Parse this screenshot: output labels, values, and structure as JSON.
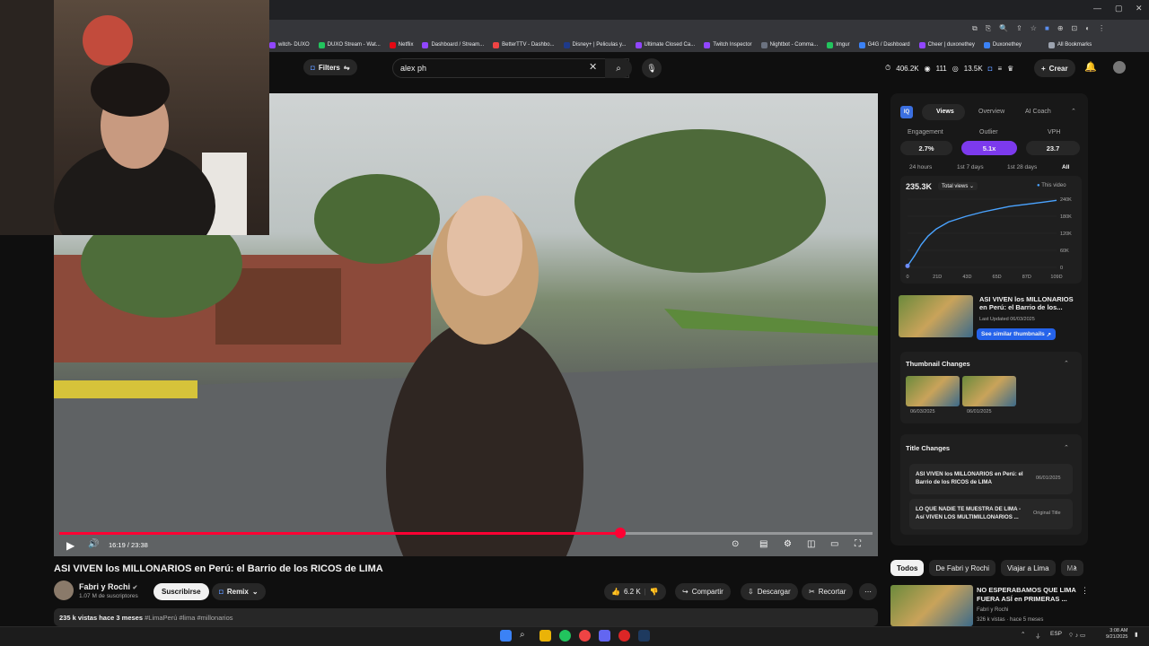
{
  "bookmarks": [
    "witch- DUXO",
    "DUXO Stream - Wat...",
    "Netflix",
    "Dashboard / Stream...",
    "BetterTTV - Dashbo...",
    "Disney+ | Peliculas y...",
    "Ultimate Closed Ca...",
    "Twitch Inspector",
    "Nightbot - Comma...",
    "Imgur",
    "G4G / Dashboard",
    "Cheer | duxonethey",
    "Duxonethey",
    "All Bookmarks"
  ],
  "header": {
    "filters_label": "Filters",
    "search_value": "alex ph",
    "stat_views": "406.2K",
    "stat_videos": "111",
    "stat_watch": "13.5K",
    "crear_label": "Crear"
  },
  "player": {
    "time": "16:19 / 23:38",
    "progress": 0.69
  },
  "video": {
    "title": "ASI VIVEN los MILLONARIOS en Perú: el Barrio de los RICOS de LIMA",
    "channel": "Fabri y Rochi",
    "subscribers": "1.07 M de suscriptores",
    "subscribe_label": "Suscribirse",
    "remix_label": "Remix",
    "likes": "6.2 K",
    "share_label": "Compartir",
    "download_label": "Descargar",
    "clip_label": "Recortar",
    "desc_views": "235 k vistas",
    "desc_age": "hace 3 meses",
    "desc_tags": "#LimaPerú #lima #millonarios"
  },
  "panel": {
    "logo": "IQ",
    "tabs": [
      "Views",
      "Overview",
      "AI Coach"
    ],
    "metrics": [
      {
        "label": "Engagement",
        "value": "2.7%"
      },
      {
        "label": "Outlier",
        "value": "5.1x"
      },
      {
        "label": "VPH",
        "value": "23.7"
      }
    ],
    "ranges": [
      "24 hours",
      "1st 7 days",
      "1st 28 days",
      "All"
    ],
    "total": "235.3K",
    "total_select": "Total views",
    "legend": "This video",
    "related_title": "ASI VIVEN los MILLONARIOS en Perú: el Barrio de los...",
    "related_date": "Last Updated 06/03/2025",
    "similar_btn": "See similar thumbnails",
    "thumb_changes_title": "Thumbnail Changes",
    "thumb_dates": [
      "06/03/2025",
      "06/01/2025"
    ],
    "title_changes_title": "Title Changes",
    "title_changes": [
      {
        "text": "ASI VIVEN los MILLONARIOS en Perú: el Barrio de los RICOS de LIMA",
        "date": "06/01/2025"
      },
      {
        "text": "LO QUE NADIE TE MUESTRA DE LIMA - Así VIVEN LOS MULTIMILLONARIOS ...",
        "date": "Original Title"
      }
    ]
  },
  "chart_data": {
    "type": "line",
    "x": [
      0,
      5,
      10,
      15,
      21,
      30,
      43,
      55,
      65,
      75,
      87,
      100,
      109
    ],
    "values": [
      5,
      40,
      80,
      110,
      135,
      160,
      180,
      195,
      205,
      215,
      222,
      230,
      236
    ],
    "xticks": [
      "0",
      "21D",
      "43D",
      "65D",
      "87D",
      "109D"
    ],
    "yticks": [
      "240K",
      "180K",
      "120K",
      "60K",
      "0"
    ],
    "ylim": [
      0,
      240
    ],
    "series_name": "This video"
  },
  "chips": [
    "Todos",
    "De Fabri y Rochi",
    "Viajar a Lima",
    "Ma"
  ],
  "rec": {
    "title": "NO ESPERABAMOS QUE LIMA FUERA ASÍ en PRIMERAS ...",
    "channel": "Fabri y Rochi",
    "meta": "326 k vistas · hace 5 meses"
  },
  "taskbar": {
    "lang": "ESP",
    "time": "3:08 AM",
    "date": "9/21/2025"
  }
}
